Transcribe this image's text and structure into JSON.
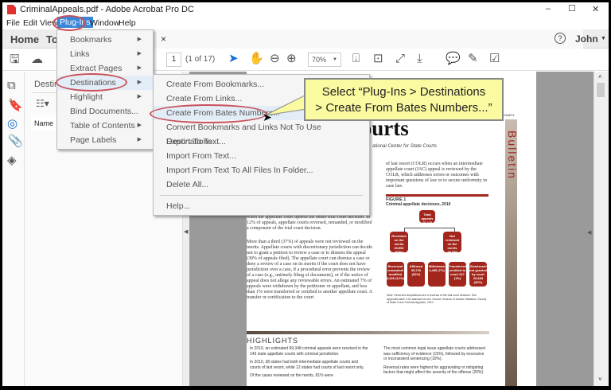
{
  "window": {
    "title": "CriminalAppeals.pdf - Adobe Acrobat Pro DC",
    "controls": [
      "–",
      "☐",
      "✕"
    ]
  },
  "menubar": [
    "File",
    "Edit",
    "View",
    "Plug-Ins",
    "Window",
    "Help"
  ],
  "tabs": {
    "home": "Home",
    "tools": "Tools",
    "close": "×"
  },
  "user": {
    "help": "?",
    "name": "John"
  },
  "toolbar": {
    "page_input": "1",
    "page_of": "(1 of 17)",
    "zoom": "70%"
  },
  "panel": {
    "title": "Destinations",
    "column": "Name"
  },
  "plugins_menu": [
    {
      "label": "Bookmarks",
      "submenu": true
    },
    {
      "label": "Links",
      "submenu": true
    },
    {
      "label": "Extract Pages",
      "submenu": true
    },
    {
      "label": "Destinations",
      "submenu": true,
      "highlighted": true
    },
    {
      "label": "Highlight",
      "submenu": true
    },
    {
      "label": "Bind Documents...",
      "submenu": false
    },
    {
      "label": "Table of Contents",
      "submenu": true
    },
    {
      "label": "Page Labels",
      "submenu": true
    }
  ],
  "destinations_menu": [
    "Create From Bookmarks...",
    "Create From Links...",
    "Create From Bates Numbers...",
    "Convert Bookmarks and Links Not To Use Destinations...",
    "Export To Text...",
    "Import From Text...",
    "Import From Text To All Files In Folder...",
    "Delete All...",
    "Help..."
  ],
  "callout": {
    "line1": "Select “Plug-Ins > Destinations",
    "line2": "> Create From Bates Numbers...”"
  },
  "document": {
    "headline": "ls in State Courts",
    "byline": "ational Center for State Courts",
    "number": "248874",
    "side": "Bulletin",
    "right_para": "of last resort (COLR) occurs when an intermediate appellate court (IAC) appeal is reviewed by the COLR, which addresses errors or outcomes with important questions of law or to secure uniformity in case law.",
    "figure_label": "FIGURE 1",
    "figure_title": "Criminal appellate decisions, 2010",
    "left_para1": "when the appellate court upheld the entire trial court decision. In 12% of appeals, appellate courts reversed, remanded, or modified a component of the trial court decision.",
    "left_para2": "More than a third (37%) of appeals were not reviewed on the merits. Appellate courts with discretionary jurisdiction can decide not to grant a petition to review a case or to dismiss the appeal (30% of appeals filed). The appellate court can dismiss a case or deny a review of a case on its merits if the court does not have jurisdiction over a case, if a procedural error prevents the review of a case (e.g., untimely filing of documents), or if the notice of appeal does not allege any reviewable errors. An estimated 7% of appeals were withdrawn by the petitioner or appellant, and less than 1% were transferred or certified to another appellate court. A transfer or certification to the court",
    "boxes": {
      "total": "Total appeals 69,348",
      "reviewed": "Reviewed on the merits 43,952 (63%)",
      "not_reviewed": "Not reviewed on the merits 25,395 (37%)",
      "reversed": "Reversed/ remanded/ modified 8,326 (12%)",
      "affirmed": "Affirmed 35,726 (52%)",
      "withdrawn": "Withdrawn 4,485 (7%)",
      "transferred": "Transferred/ certified to court 227 (1%)",
      "dismissed": "Dismissed/ not granted by court 20,683 (30%)"
    },
    "note": "Note: Reversed dispositions are a reversal of the trial court decision. See appendix table 3 for standard errors. Source: Bureau of Justice Statistics, Survey of State Court Criminal Appeals, 2010.",
    "highlights_title": "HIGHLIGHTS",
    "highlights_left": [
      "In 2010, an estimated 69,348 criminal appeals were resolved in the 143 state appellate courts with criminal jurisdiction.",
      "In 2010, 38 states had both intermediate appellate courts and courts of last resort, while 12 states had courts of last resort only.",
      "Of the cases reviewed on the merits, 81% were"
    ],
    "highlights_right": [
      "The most common legal issue appellate courts addressed was sufficiency of evidence (15%), followed by excessive or inconsistent sentencing (10%).",
      "Reversal rates were highest for aggravating or mitigating factors that might affect the severity of the offense (20%)."
    ]
  },
  "colors": {
    "highlight": "#e3edf7",
    "annotation": "#c9505a",
    "callout": "#fafaa0",
    "report_red": "#a3261c"
  }
}
